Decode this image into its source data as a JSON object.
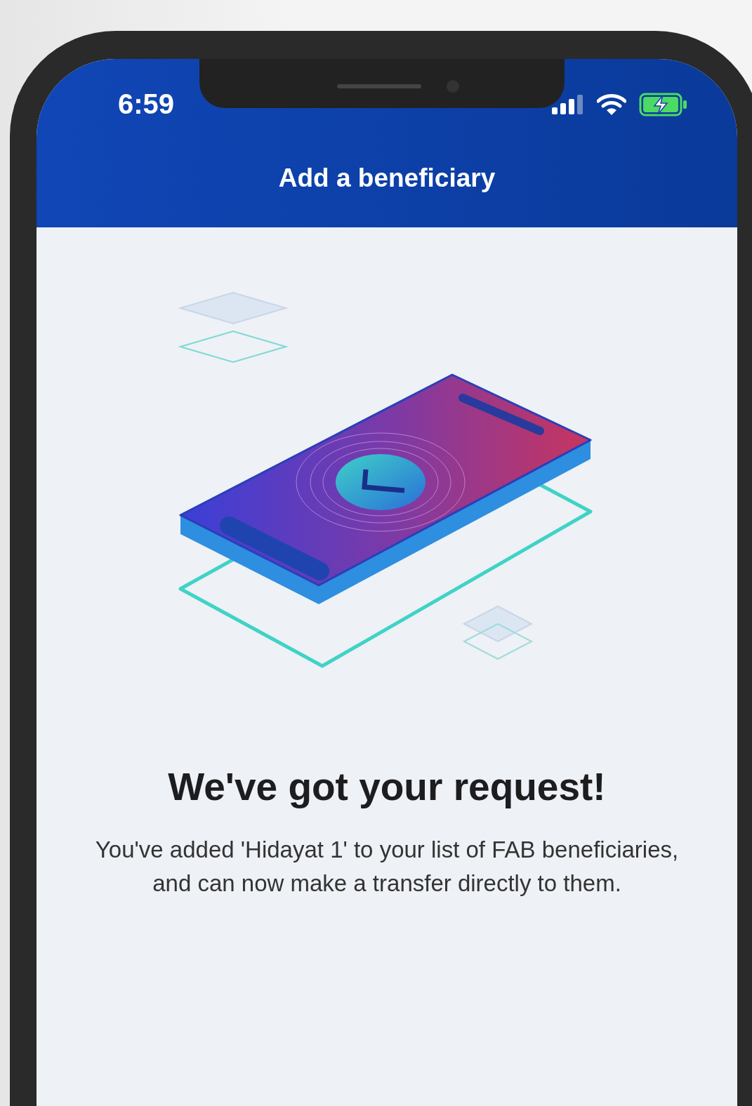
{
  "status_bar": {
    "time": "6:59"
  },
  "header": {
    "title": "Add a beneficiary"
  },
  "confirmation": {
    "heading": "We've got your request!",
    "message": "You've added 'Hidayat 1' to your list of FAB beneficiaries, and can now make a transfer directly to them."
  }
}
